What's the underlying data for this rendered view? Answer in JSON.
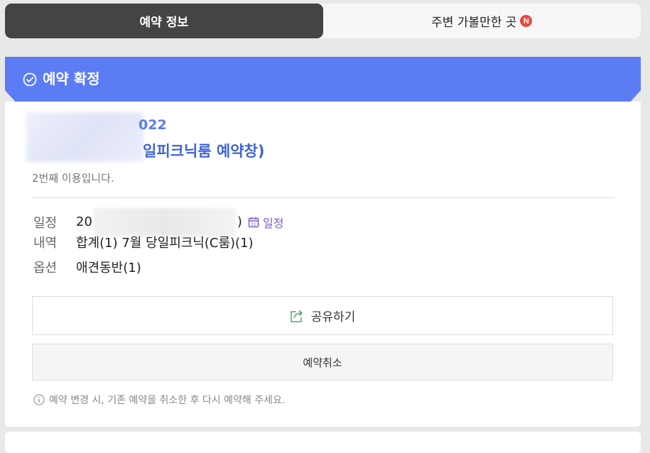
{
  "tabs": {
    "reservation_info": "예약 정보",
    "nearby": "주변 가볼만한 곳",
    "nearby_badge": "N"
  },
  "banner": {
    "title": "예약 확정"
  },
  "reservation": {
    "title_line1_visible": "022",
    "title_line2_visible": "일피크닉룸 예약창)",
    "visit_count": "2번째 이용입니다.",
    "schedule_label": "일정",
    "schedule_value_visible": "20",
    "schedule_value_tail": ")",
    "calendar_link": "일정",
    "details_label": "내역",
    "details_value": "합계(1) 7월 당일피크닉(C룸)(1)",
    "option_label": "옵션",
    "option_value": "애견동반(1)"
  },
  "actions": {
    "share": "공유하기",
    "cancel": "예약취소"
  },
  "notice": "예약 변경 시, 기존 예약을 취소한 후 다시 예약해 주세요.",
  "colors": {
    "banner": "#5b7cf5",
    "title": "#3f62d9",
    "calendar_link": "#7a5cc9",
    "badge": "#e8473f"
  }
}
